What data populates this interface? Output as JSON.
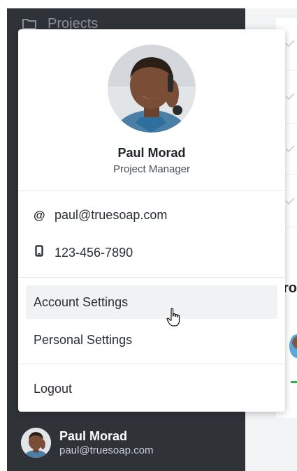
{
  "sidebar": {
    "top_label": "Projects",
    "folder_icon": "folder-icon"
  },
  "right": {
    "partial_heading": "ro"
  },
  "profile": {
    "name": "Paul Morad",
    "role": "Project Manager",
    "email": "paul@truesoap.com",
    "phone": "123-456-7890",
    "email_icon": "@",
    "phone_icon": "phone-icon"
  },
  "menu": {
    "items": [
      {
        "label": "Account Settings"
      },
      {
        "label": "Personal Settings"
      }
    ],
    "logout": "Logout"
  },
  "footer": {
    "name": "Paul Morad",
    "email": "paul@truesoap.com"
  },
  "colors": {
    "sidebar_bg": "#2f3338",
    "accent_green": "#34b24a"
  }
}
